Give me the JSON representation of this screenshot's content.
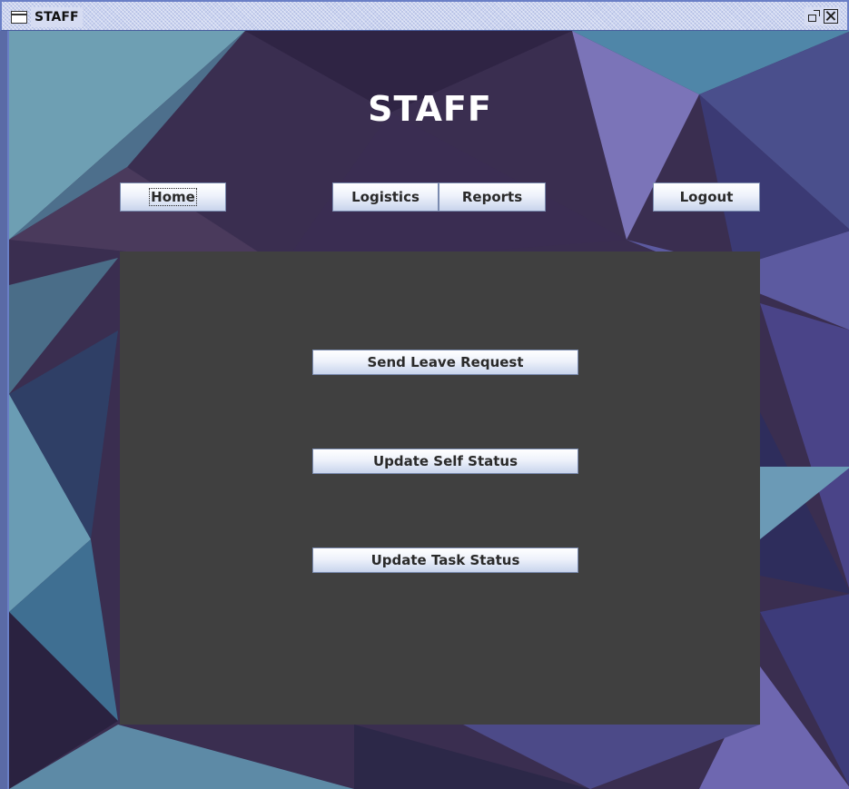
{
  "window": {
    "title": "STAFF"
  },
  "header": {
    "title": "STAFF"
  },
  "nav": {
    "home": "Home",
    "logistics": "Logistics",
    "reports": "Reports",
    "logout": "Logout"
  },
  "actions": {
    "leave_request": "Send Leave Request",
    "self_status": "Update Self Status",
    "task_status": "Update Task Status"
  }
}
